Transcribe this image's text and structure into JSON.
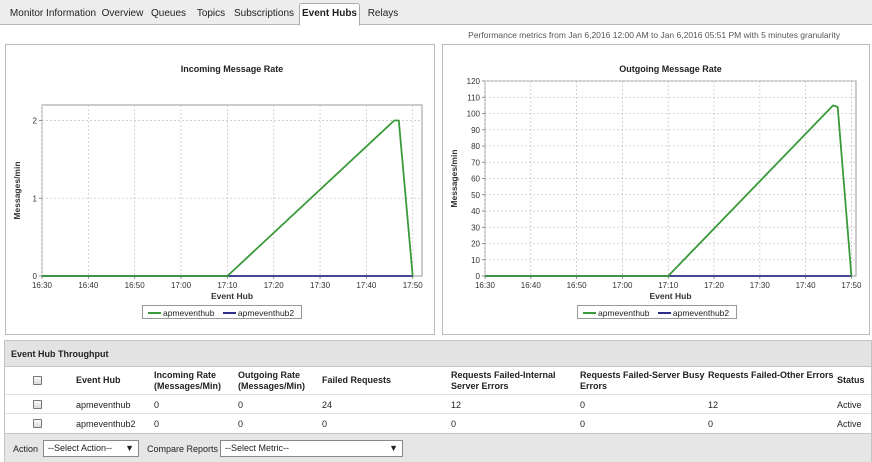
{
  "tabs": [
    {
      "label": "Monitor Information",
      "active": false
    },
    {
      "label": "Overview",
      "active": false
    },
    {
      "label": "Queues",
      "active": false
    },
    {
      "label": "Topics",
      "active": false
    },
    {
      "label": "Subscriptions",
      "active": false
    },
    {
      "label": "Event Hubs",
      "active": true
    },
    {
      "label": "Relays",
      "active": false
    }
  ],
  "performance_text": "Performance metrics from Jan 6,2016 12:00 AM to Jan 6,2016 05:51 PM with 5 minutes granularity",
  "chart_data": [
    {
      "type": "line",
      "title": "Incoming Message Rate",
      "xlabel": "Event Hub",
      "ylabel": "Messages/min",
      "x_ticks": [
        "16:30",
        "16:40",
        "16:50",
        "17:00",
        "17:10",
        "17:20",
        "17:30",
        "17:40",
        "17:50"
      ],
      "xlim": [
        "16:30",
        "17:52"
      ],
      "ylim": [
        0,
        2.2
      ],
      "y_ticks": [
        0,
        1,
        2
      ],
      "grid": true,
      "legend": "bottom-center",
      "series": [
        {
          "name": "apmeventhub",
          "color": "#3a9a3a",
          "x": [
            "16:30",
            "17:10",
            "17:46",
            "17:47",
            "17:50"
          ],
          "values": [
            0,
            0,
            2,
            2,
            0
          ]
        },
        {
          "name": "apmeventhub2",
          "color": "#2d2d8a",
          "x": [
            "16:30",
            "17:50"
          ],
          "values": [
            0,
            0
          ]
        }
      ]
    },
    {
      "type": "line",
      "title": "Outgoing Message Rate",
      "xlabel": "Event Hub",
      "ylabel": "Messages/min",
      "x_ticks": [
        "16:30",
        "16:40",
        "16:50",
        "17:00",
        "17:10",
        "17:20",
        "17:30",
        "17:40",
        "17:50"
      ],
      "xlim": [
        "16:30",
        "17:51"
      ],
      "ylim": [
        0,
        120
      ],
      "y_ticks": [
        0,
        10,
        20,
        30,
        40,
        50,
        60,
        70,
        80,
        90,
        100,
        110,
        120
      ],
      "grid": true,
      "legend": "bottom-center",
      "series": [
        {
          "name": "apmeventhub",
          "color": "#3a9a3a",
          "x": [
            "16:30",
            "17:10",
            "17:46",
            "17:47",
            "17:50"
          ],
          "values": [
            0,
            0,
            105,
            104,
            0
          ]
        },
        {
          "name": "apmeventhub2",
          "color": "#2d2d8a",
          "x": [
            "16:30",
            "17:50"
          ],
          "values": [
            0,
            0
          ]
        }
      ]
    }
  ],
  "throughput": {
    "title": "Event Hub Throughput",
    "columns": [
      [
        "Event Hub"
      ],
      [
        "Incoming Rate",
        "(Messages/Min)"
      ],
      [
        "Outgoing Rate",
        "(Messages/Min)"
      ],
      [
        "Failed Requests"
      ],
      [
        "Requests Failed-Internal",
        "Server Errors"
      ],
      [
        "Requests Failed-Server Busy",
        "Errors"
      ],
      [
        "Requests Failed-Other Errors"
      ],
      [
        "Status"
      ]
    ],
    "rows": [
      [
        "apmeventhub",
        "0",
        "0",
        "24",
        "12",
        "0",
        "12",
        "Active"
      ],
      [
        "apmeventhub2",
        "0",
        "0",
        "0",
        "0",
        "0",
        "0",
        "Active"
      ]
    ]
  },
  "footer": {
    "action_label": "Action",
    "action_value": "--Select Action--",
    "compare_label": "Compare Reports",
    "compare_value": "--Select Metric--"
  }
}
